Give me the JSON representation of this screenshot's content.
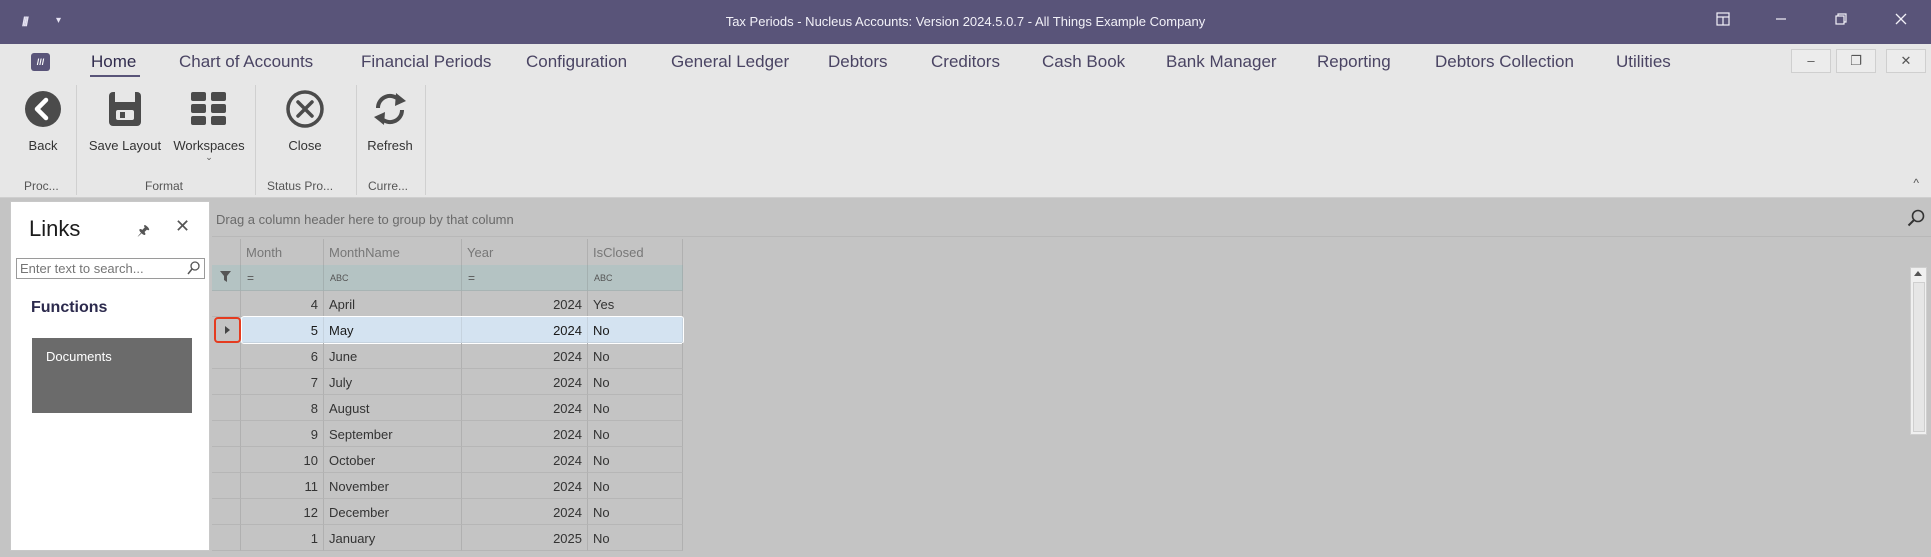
{
  "window": {
    "title": "Tax Periods - Nucleus Accounts: Version 2024.5.0.7 - All Things Example Company",
    "app_icon_text": "///",
    "app_dropdown": "▾"
  },
  "menu": {
    "logo_text": "///",
    "tabs": [
      "Home",
      "Chart of Accounts",
      "Financial Periods",
      "Configuration",
      "General Ledger",
      "Debtors",
      "Creditors",
      "Cash Book",
      "Bank Manager",
      "Reporting",
      "Debtors Collection",
      "Utilities"
    ],
    "active_tab": "Home"
  },
  "ribbon": {
    "buttons": {
      "back": "Back",
      "save_layout": "Save Layout",
      "workspaces": "Workspaces",
      "close": "Close",
      "refresh": "Refresh"
    },
    "groups": {
      "process": "Proc...",
      "format": "Format",
      "status": "Status Pro...",
      "current": "Curre..."
    }
  },
  "links_panel": {
    "title": "Links",
    "search_placeholder": "Enter text to search...",
    "section": "Functions",
    "items": [
      "Documents"
    ]
  },
  "grid": {
    "group_hint": "Drag a column header here to group by that column",
    "columns": [
      "Month",
      "MonthName",
      "Year",
      "IsClosed"
    ],
    "filter_symbols": [
      "=",
      "ABC",
      "=",
      "ABC"
    ],
    "rows": [
      {
        "month": "4",
        "month_name": "April",
        "year": "2024",
        "is_closed": "Yes"
      },
      {
        "month": "5",
        "month_name": "May",
        "year": "2024",
        "is_closed": "No"
      },
      {
        "month": "6",
        "month_name": "June",
        "year": "2024",
        "is_closed": "No"
      },
      {
        "month": "7",
        "month_name": "July",
        "year": "2024",
        "is_closed": "No"
      },
      {
        "month": "8",
        "month_name": "August",
        "year": "2024",
        "is_closed": "No"
      },
      {
        "month": "9",
        "month_name": "September",
        "year": "2024",
        "is_closed": "No"
      },
      {
        "month": "10",
        "month_name": "October",
        "year": "2024",
        "is_closed": "No"
      },
      {
        "month": "11",
        "month_name": "November",
        "year": "2024",
        "is_closed": "No"
      },
      {
        "month": "12",
        "month_name": "December",
        "year": "2024",
        "is_closed": "No"
      },
      {
        "month": "1",
        "month_name": "January",
        "year": "2025",
        "is_closed": "No"
      }
    ],
    "selected_row_index": 1
  },
  "colors": {
    "titlebar": "#595479",
    "accent": "#312c4e",
    "selection": "#d4e3f1",
    "indicator_border": "#e53b1f"
  }
}
